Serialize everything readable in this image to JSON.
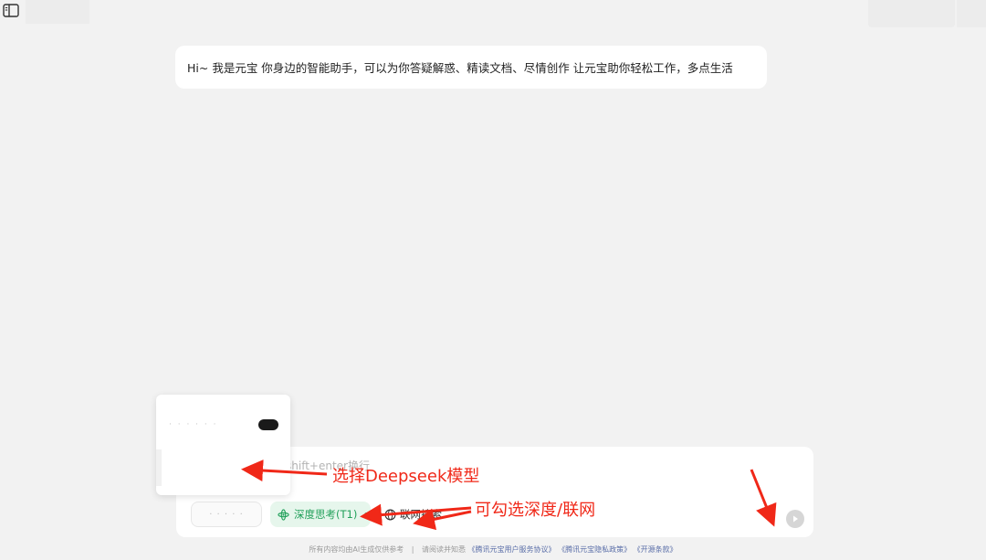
{
  "greeting": {
    "text": "Hi~ 我是元宝 你身边的智能助手，可以为你答疑解惑、精读文档、尽情创作 让元宝助你轻松工作，多点生活"
  },
  "composer": {
    "placeholder": "shift+enter换行",
    "model_label": "· · · · ·",
    "deep_think_label": "深度思考(T1)",
    "web_search_label": "联网搜索"
  },
  "model_popup": {
    "option_label": "· · · · · ·"
  },
  "footer": {
    "disclaimer": "所有内容均由AI生成仅供参考",
    "separator": "|",
    "read_prefix": "请阅读并知悉",
    "links": [
      "《腾讯元宝用户服务协议》",
      "《腾讯元宝隐私政策》",
      "《开源条款》"
    ]
  },
  "annotations": {
    "select_model": "选择Deepseek模型",
    "toggle_options": "可勾选深度/联网"
  },
  "colors": {
    "accent_green": "#21a05a",
    "annotation_red": "#f02818",
    "link_blue": "#5a6ea8"
  },
  "icons": {
    "sidebar_toggle": "sidebar-toggle-icon",
    "deep_think": "atom-icon",
    "web_search": "globe-icon",
    "send": "send-icon"
  }
}
